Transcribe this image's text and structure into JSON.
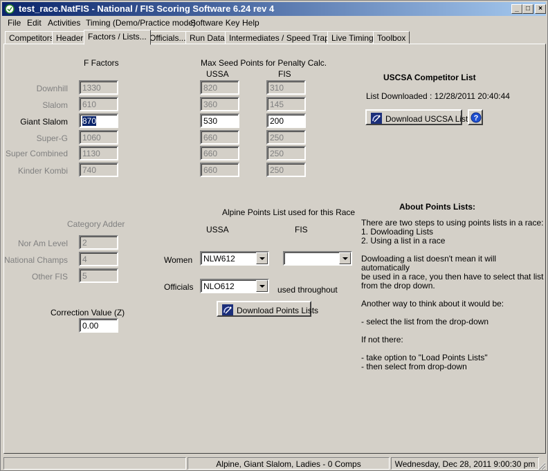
{
  "window": {
    "title": "test_race.NatFIS - National / FIS Scoring Software 6.24 rev 4",
    "minimize": "_",
    "maximize": "□",
    "close": "×"
  },
  "menu": [
    {
      "label": "File"
    },
    {
      "label": "Edit"
    },
    {
      "label": "Activities"
    },
    {
      "label": "Timing (Demo/Practice mode)"
    },
    {
      "label": "Software Key"
    },
    {
      "label": "Help"
    }
  ],
  "tabs": [
    {
      "label": "Competitors"
    },
    {
      "label": "Header"
    },
    {
      "label": "Factors / Lists..."
    },
    {
      "label": "Officials..."
    },
    {
      "label": "Run Data"
    },
    {
      "label": "Intermediates / Speed Traps"
    },
    {
      "label": "Live Timing"
    },
    {
      "label": "Toolbox"
    }
  ],
  "factors": {
    "heading": "F Factors",
    "rows": [
      {
        "label": "Downhill",
        "value": "1330"
      },
      {
        "label": "Slalom",
        "value": "610"
      },
      {
        "label": "Giant Slalom",
        "value": "870"
      },
      {
        "label": "Super-G",
        "value": "1060"
      },
      {
        "label": "Super Combined",
        "value": "1130"
      },
      {
        "label": "Kinder Kombi",
        "value": "740"
      }
    ]
  },
  "seed_points": {
    "heading": "Max Seed Points for Penalty Calc.",
    "ussa_header": "USSA",
    "fis_header": "FIS",
    "rows": [
      {
        "ussa": "820",
        "fis": "310"
      },
      {
        "ussa": "360",
        "fis": "145"
      },
      {
        "ussa": "530",
        "fis": "200"
      },
      {
        "ussa": "660",
        "fis": "250"
      },
      {
        "ussa": "660",
        "fis": "250"
      },
      {
        "ussa": "660",
        "fis": "250"
      }
    ]
  },
  "uscsa": {
    "heading": "USCSA Competitor List",
    "downloaded": "List Downloaded : 12/28/2011 20:40:44",
    "download_button": "Download USCSA List",
    "help_icon": "?"
  },
  "category": {
    "heading": "Category Adder",
    "rows": [
      {
        "label": "Nor Am Level",
        "value": "2"
      },
      {
        "label": "National Champs",
        "value": "4"
      },
      {
        "label": "Other FIS",
        "value": "5"
      }
    ]
  },
  "correction": {
    "label": "Correction Value (Z)",
    "value": "0.00"
  },
  "points_list": {
    "heading": "Alpine Points List used for this Race",
    "ussa_header": "USSA",
    "fis_header": "FIS",
    "women_label": "Women",
    "women_ussa": "NLW612",
    "women_fis": "",
    "officials_label": "Officials",
    "officials_ussa": "NLO612",
    "used_throughout": "used throughout",
    "download_button": "Download Points Lists"
  },
  "about": {
    "heading": "About Points Lists:",
    "lines": [
      "There are two steps to using points lists in a race:",
      "1. Dowloading Lists",
      "2. Using a list in a race",
      "",
      "Dowloading a list doesn't mean it will automatically",
      "be used in a race, you then have to select that list",
      "from the drop down.",
      "",
      "Another way to think about it would be:",
      "",
      "- select the list from the drop-down",
      "",
      "If not there:",
      "",
      "- take option to \"Load Points Lists\"",
      "- then select from drop-down"
    ]
  },
  "status": {
    "left": "",
    "middle": "Alpine, Giant Slalom, Ladies - 0 Comps",
    "right": "Wednesday, Dec 28, 2011   9:00:30 pm"
  },
  "colors": {
    "face": "#d4d0c8",
    "title_start": "#0a246a",
    "title_end": "#a6caf0",
    "disabled_text": "#808080"
  }
}
